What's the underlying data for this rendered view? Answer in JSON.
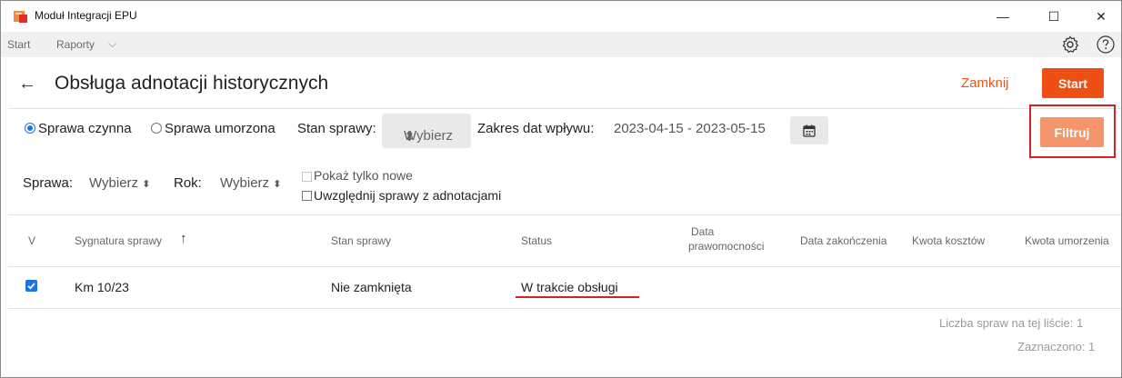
{
  "window": {
    "title": "Moduł Integracji EPU",
    "controls": {
      "minimize": "—",
      "maximize": "☐",
      "close": "✕"
    }
  },
  "menu": {
    "start": "Start",
    "raporty": "Raporty",
    "raporty_chevron": "⌵"
  },
  "header": {
    "back": "←",
    "title": "Obsługa adnotacji historycznych",
    "close_label": "Zamknij",
    "start_label": "Start"
  },
  "filters": {
    "radio_active": "Sprawa czynna",
    "radio_discontinued": "Sprawa umorzona",
    "stan_label": "Stan sprawy:",
    "stan_value": "Wybierz",
    "select_arrow": "⬍",
    "date_label": "Zakres dat wpływu:",
    "date_range": "2023-04-15 - 2023-05-15",
    "filter_label": "Filtruj",
    "sprawa_label": "Sprawa:",
    "sprawa_value": "Wybierz",
    "rok_label": "Rok:",
    "rok_value": "Wybierz",
    "only_new_label": "Pokaż tylko nowe",
    "with_notes_label": "Uwzględnij sprawy z adnotacjami",
    "radio_active_checked": true,
    "only_new_checked": false,
    "only_new_disabled": true,
    "with_notes_checked": false
  },
  "table": {
    "headers": {
      "v": "V",
      "sygnatura": "Sygnatura sprawy",
      "sort_icon": "↑",
      "stan": "Stan sprawy",
      "status": "Status",
      "data_prawomocnosci_1": "Data",
      "data_prawomocnosci_2": "prawomocności",
      "data_zakonczenia": "Data zakończenia",
      "kwota_kosztow": "Kwota kosztów",
      "kwota_umorzenia": "Kwota umorzenia"
    },
    "rows": [
      {
        "checked": true,
        "sygnatura": "Km 10/23",
        "stan": "Nie zamknięta",
        "status": "W trakcie obsługi"
      }
    ]
  },
  "footer": {
    "count_text": "Liczba spraw na tej liście: 1",
    "selected_text": "Zaznaczono: 1"
  },
  "colors": {
    "accent": "#ee4f15",
    "accent_disabled": "#f5956c",
    "highlight_red": "#d61f26",
    "checkbox_blue": "#1a73e8"
  }
}
